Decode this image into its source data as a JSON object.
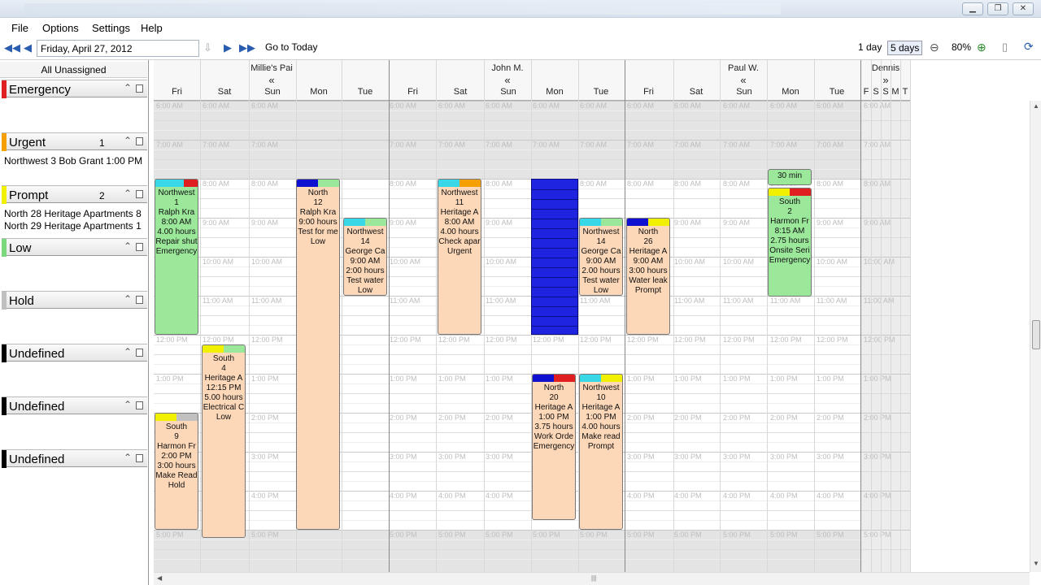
{
  "menu": [
    "File",
    "Options",
    "Settings",
    "Help"
  ],
  "toolbar": {
    "date": "Friday, April 27, 2012",
    "goto_today": "Go to Today",
    "view_1day": "1 day",
    "view_5days": "5 days",
    "zoom": "80%"
  },
  "left": {
    "all_unassigned": "All Unassigned",
    "groups": [
      {
        "name": "Emergency",
        "count": "",
        "color": "#e02020"
      },
      {
        "name": "Urgent",
        "count": "1",
        "color": "#f5a000"
      },
      {
        "name": "Prompt",
        "count": "2",
        "color": "#f0f000"
      },
      {
        "name": "Low",
        "count": "",
        "color": "#7cd87c"
      },
      {
        "name": "Hold",
        "count": "",
        "color": "#c0c0c0"
      },
      {
        "name": "Undefined",
        "count": "",
        "color": "#000000"
      },
      {
        "name": "Undefined",
        "count": "",
        "color": "#000000"
      },
      {
        "name": "Undefined",
        "count": "",
        "color": "#000000"
      }
    ],
    "urgent_items": [
      "Northwest  3  Bob Grant  1:00 PM"
    ],
    "prompt_items": [
      "North  28  Heritage Apartments  8",
      "North  29  Heritage Apartments  1"
    ]
  },
  "resources": [
    {
      "name": "Millie's Pai",
      "days": [
        "Fri",
        "Sat",
        "Sun",
        "Mon",
        "Tue"
      ]
    },
    {
      "name": "John M.",
      "days": [
        "Fri",
        "Sat",
        "Sun",
        "Mon",
        "Tue"
      ]
    },
    {
      "name": "Paul W.",
      "days": [
        "Fri",
        "Sat",
        "Sun",
        "Mon",
        "Tue"
      ]
    },
    {
      "name": "Dennis",
      "days": [
        "F",
        "S",
        "S",
        "M",
        "T"
      ]
    }
  ],
  "times": [
    "6:00 AM",
    "7:00 AM",
    "8:00 AM",
    "9:00 AM",
    "10:00 AM",
    "11:00 AM",
    "12:00 PM",
    "1:00 PM",
    "2:00 PM",
    "3:00 PM",
    "4:00 PM",
    "5:00 PM"
  ],
  "jobs": [
    {
      "lines": [
        "Northwest",
        "1",
        "Ralph Kra",
        "8:00 AM",
        "4.00 hours",
        "Repair shut",
        "Emergency"
      ],
      "caps": [
        "#38d8e8",
        "#38d8e8",
        "#e02020"
      ],
      "bg": "#9be89b"
    },
    {
      "lines": [
        "South",
        "4",
        "Heritage A",
        "12:15 PM",
        "5.00 hours",
        "Electrical C",
        "Low"
      ],
      "caps": [
        "#f0f000",
        "#9be89b"
      ],
      "bg": "#fcd7b8"
    },
    {
      "lines": [
        "South",
        "9",
        "Harmon Fr",
        "2:00 PM",
        "3:00 hours",
        "Make Read",
        "Hold"
      ],
      "caps": [
        "#f0f000",
        "#c0c0c0"
      ],
      "bg": "#fcd7b8"
    },
    {
      "lines": [
        "North",
        "12",
        "Ralph Kra",
        "9:00 hours",
        "Test for me",
        "Low"
      ],
      "caps": [
        "#1010d0",
        "#9be89b"
      ],
      "bg": "#fcd7b8"
    },
    {
      "lines": [
        "Northwest",
        "14",
        "George Ca",
        "9:00 AM",
        "2:00 hours",
        "Test water",
        "Low"
      ],
      "caps": [
        "#38d8e8",
        "#9be89b"
      ],
      "bg": "#fcd7b8"
    },
    {
      "lines": [
        "Northwest",
        "11",
        "Heritage A",
        "8:00 AM",
        "4.00 hours",
        "Check apar",
        "Urgent"
      ],
      "caps": [
        "#38d8e8",
        "#f5a000"
      ],
      "bg": "#fcd7b8"
    },
    {
      "lines": [
        "North",
        "20",
        "Heritage A",
        "1:00 PM",
        "3.75 hours",
        "Work Orde",
        "Emergency"
      ],
      "caps": [
        "#1010d0",
        "#e02020"
      ],
      "bg": "#fcd7b8"
    },
    {
      "lines": [
        "Northwest",
        "14",
        "George Ca",
        "9:00 AM",
        "2.00 hours",
        "Test water",
        "Low"
      ],
      "caps": [
        "#38d8e8",
        "#9be89b"
      ],
      "bg": "#fcd7b8"
    },
    {
      "lines": [
        "Northwest",
        "10",
        "Heritage A",
        "1:00 PM",
        "4.00 hours",
        "Make read",
        "Prompt"
      ],
      "caps": [
        "#38d8e8",
        "#f0f000"
      ],
      "bg": "#fcd7b8"
    },
    {
      "lines": [
        "North",
        "26",
        "Heritage A",
        "9:00 AM",
        "3:00 hours",
        "Water leak",
        "Prompt"
      ],
      "caps": [
        "#1010d0",
        "#f0f000"
      ],
      "bg": "#fcd7b8"
    },
    {
      "lines": [
        "30 min"
      ],
      "caps": [],
      "bg": "#9be89b"
    },
    {
      "lines": [
        "South",
        "2",
        "Harmon Fr",
        "8:15 AM",
        "2.75 hours",
        "Onsite Seri",
        "Emergency"
      ],
      "caps": [
        "#f0f000",
        "#e02020"
      ],
      "bg": "#9be89b"
    }
  ]
}
